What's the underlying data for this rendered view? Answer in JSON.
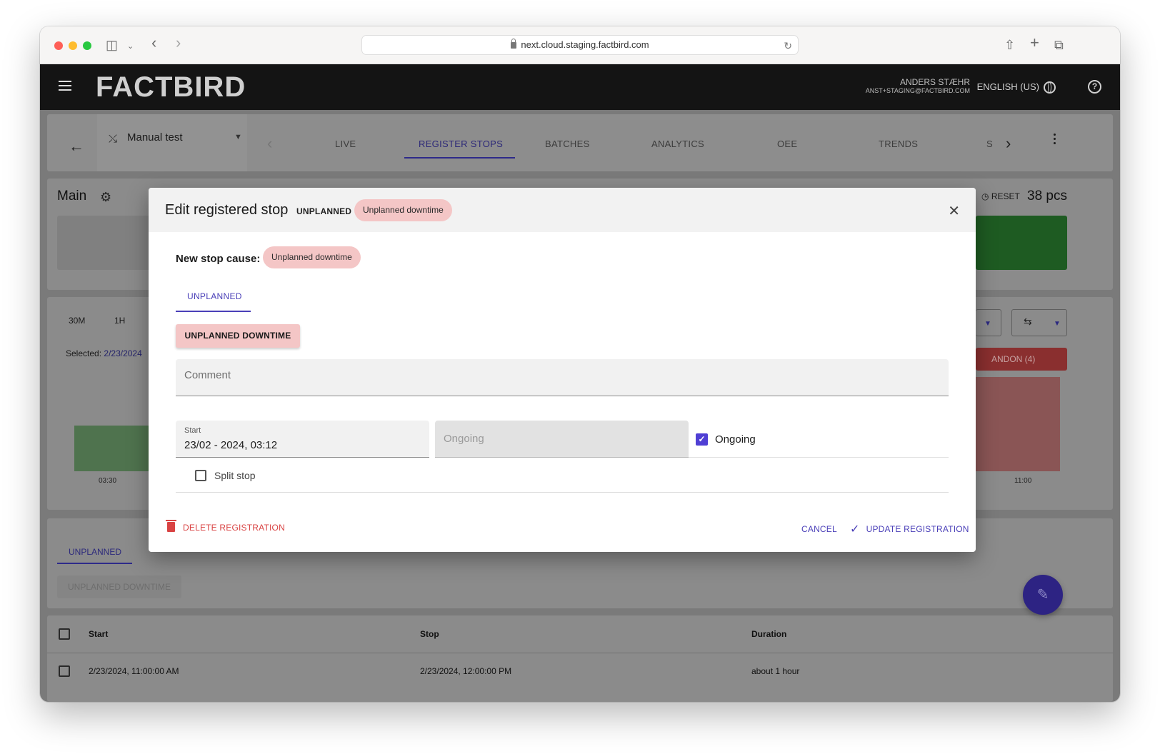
{
  "browser": {
    "url": "next.cloud.staging.factbird.com"
  },
  "header": {
    "logo": "FACTBIRD",
    "user_name": "ANDERS STÆHR",
    "user_email": "ANST+STAGING@FACTBIRD.COM",
    "language": "ENGLISH (US)"
  },
  "nav": {
    "line": "Manual test",
    "tabs": [
      "LIVE",
      "REGISTER STOPS",
      "BATCHES",
      "ANALYTICS",
      "OEE",
      "TRENDS",
      "S"
    ],
    "active_tab": "REGISTER STOPS"
  },
  "main": {
    "title": "Main",
    "reset_label": "RESET",
    "count": "38 pcs"
  },
  "chart": {
    "ranges": [
      "30M",
      "1H"
    ],
    "selected_label": "Selected:",
    "selected_value": "2/23/2024",
    "x_ticks": [
      "03:30",
      "11:00"
    ],
    "andon_label": "ANDON (4)"
  },
  "stops_panel": {
    "tab": "UNPLANNED",
    "button": "UNPLANNED DOWNTIME"
  },
  "table": {
    "columns": [
      "Start",
      "Stop",
      "Duration"
    ],
    "rows": [
      {
        "start": "2/23/2024, 11:00:00 AM",
        "stop": "2/23/2024, 12:00:00 PM",
        "duration": "about 1 hour"
      }
    ]
  },
  "modal": {
    "title": "Edit registered stop",
    "type": "UNPLANNED",
    "cause_chip": "Unplanned downtime",
    "new_cause_label": "New stop cause:",
    "new_cause_chip": "Unplanned downtime",
    "tab": "UNPLANNED",
    "cause_button": "UNPLANNED DOWNTIME",
    "comment_placeholder": "Comment",
    "start_label": "Start",
    "start_value": "23/02 - 2024, 03:12",
    "stop_placeholder": "Ongoing",
    "ongoing_label": "Ongoing",
    "ongoing_checked": true,
    "split_label": "Split stop",
    "split_checked": false,
    "delete_label": "DELETE REGISTRATION",
    "cancel_label": "CANCEL",
    "update_label": "UPDATE REGISTRATION"
  },
  "colors": {
    "accent": "#4a3fb8",
    "chip": "#f4c6c6",
    "danger": "#d94343",
    "checkbox": "#4f3fd4"
  }
}
